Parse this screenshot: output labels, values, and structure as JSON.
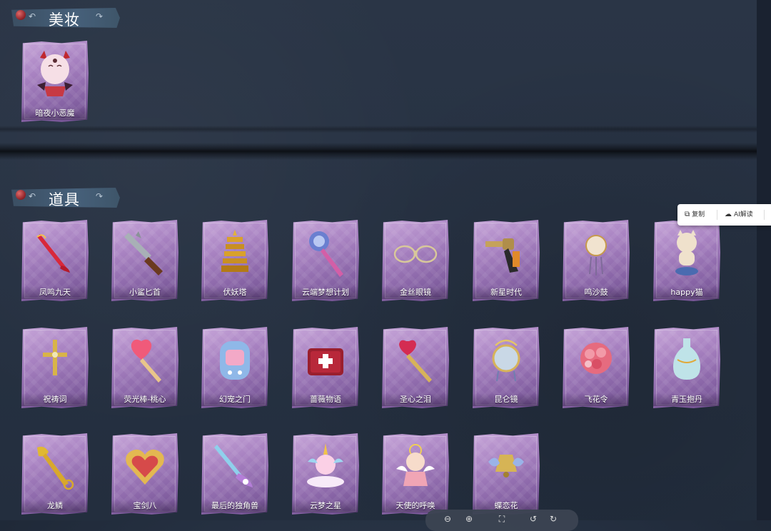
{
  "sections": {
    "cosmetics": {
      "title": "美妆"
    },
    "items": {
      "title": "道具"
    }
  },
  "cosmetics": [
    {
      "label": "暗夜小恶魔",
      "icon": "little-devil-avatar-icon"
    }
  ],
  "items": [
    {
      "label": "凤鸣九天",
      "icon": "phoenix-blade-icon"
    },
    {
      "label": "小鲨匕首",
      "icon": "shark-dagger-icon"
    },
    {
      "label": "伏妖塔",
      "icon": "golden-pagoda-icon"
    },
    {
      "label": "云端梦想计划",
      "icon": "space-mace-icon"
    },
    {
      "label": "金丝眼镜",
      "icon": "gold-glasses-icon"
    },
    {
      "label": "新星时代",
      "icon": "revolver-icon"
    },
    {
      "label": "鸣沙鼓",
      "icon": "sand-drum-icon"
    },
    {
      "label": "happy猫",
      "icon": "happy-cat-icon"
    },
    {
      "label": "祝祷词",
      "icon": "golden-cross-icon"
    },
    {
      "label": "荧光棒-桃心",
      "icon": "heart-wand-icon"
    },
    {
      "label": "幻宠之门",
      "icon": "pet-device-icon"
    },
    {
      "label": "蔷薇物语",
      "icon": "first-aid-box-icon"
    },
    {
      "label": "圣心之泪",
      "icon": "heart-scepter-icon"
    },
    {
      "label": "昆仑镜",
      "icon": "kunlun-mirror-icon"
    },
    {
      "label": "飞花令",
      "icon": "flower-bouquet-icon"
    },
    {
      "label": "青玉抱丹",
      "icon": "jade-vase-icon"
    },
    {
      "label": "龙鳞",
      "icon": "dragon-shovel-icon"
    },
    {
      "label": "宝剑八",
      "icon": "heart-locket-icon"
    },
    {
      "label": "最后的独角兽",
      "icon": "unicorn-lance-icon"
    },
    {
      "label": "云梦之星",
      "icon": "unicorn-plush-icon"
    },
    {
      "label": "天使的呼唤",
      "icon": "angel-doll-icon"
    },
    {
      "label": "蝶恋花",
      "icon": "butterfly-bell-icon"
    }
  ],
  "popup": {
    "copy_label": "复制",
    "ai_label": "AI解读"
  },
  "colors": {
    "card_purple": "#a983c2",
    "header_blue": "#46607a",
    "background": "#273243"
  }
}
